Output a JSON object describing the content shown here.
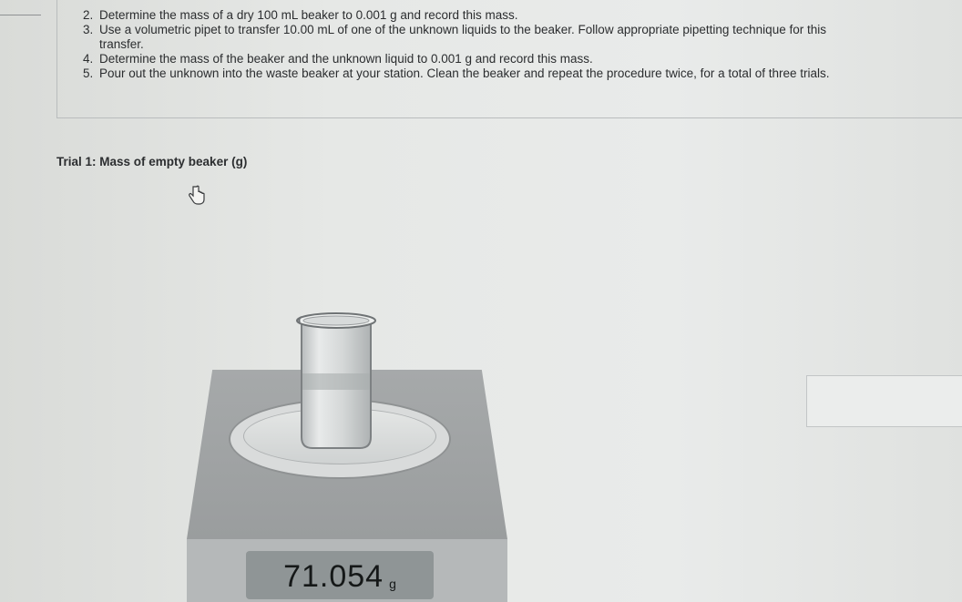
{
  "instructions": {
    "steps": [
      {
        "num": "2.",
        "text": "Determine the mass of a dry 100 mL beaker to 0.001 g and record this mass."
      },
      {
        "num": "3.",
        "text": "Use a volumetric pipet to transfer 10.00 mL of one of the unknown liquids to the beaker. Follow appropriate pipetting technique for this"
      },
      {
        "num": "",
        "text": "transfer."
      },
      {
        "num": "4.",
        "text": "Determine the mass of the beaker and the unknown liquid to 0.001 g and record this mass."
      },
      {
        "num": "5.",
        "text": "Pour out the unknown into the waste beaker at your station. Clean the beaker and repeat the procedure twice, for a total of three trials."
      }
    ]
  },
  "trial": {
    "label": "Trial 1: Mass of empty beaker (g)"
  },
  "scale": {
    "reading": "71.054",
    "unit": "g"
  },
  "icons": {
    "cursor": "hand-pointer-icon"
  },
  "colors": {
    "text": "#2a2c2d",
    "scale_body": "#a6a9aa",
    "display_bg": "#8f9596"
  }
}
